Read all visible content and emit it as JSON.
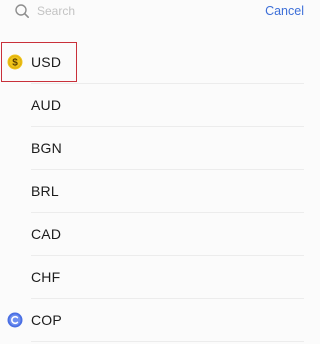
{
  "search": {
    "placeholder": "Search",
    "value": "",
    "cancel_label": "Cancel"
  },
  "currencies": [
    {
      "code": "USD",
      "icon": "dollar-coin-icon",
      "selected": true
    },
    {
      "code": "AUD",
      "icon": null,
      "selected": false
    },
    {
      "code": "BGN",
      "icon": null,
      "selected": false
    },
    {
      "code": "BRL",
      "icon": null,
      "selected": false
    },
    {
      "code": "CAD",
      "icon": null,
      "selected": false
    },
    {
      "code": "CHF",
      "icon": null,
      "selected": false
    },
    {
      "code": "COP",
      "icon": "cop-coin-icon",
      "selected": false
    }
  ],
  "colors": {
    "accent": "#3d6fd8",
    "highlight_border": "#c9303a",
    "dollar_coin": "#f0c419",
    "cop_coin": "#4a6fe3"
  }
}
